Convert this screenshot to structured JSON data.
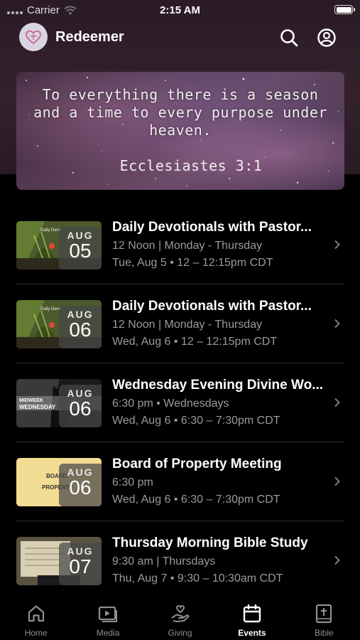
{
  "status_bar": {
    "carrier": "Carrier",
    "time": "2:15 AM"
  },
  "header": {
    "app_name": "Redeemer",
    "logo_icon": "heart-logo-icon",
    "search_icon": "search-icon",
    "profile_icon": "profile-icon"
  },
  "banner": {
    "quote": "To everything there is a season\nand a time to every purpose under\nheaven.",
    "reference": "Ecclesiastes 3:1"
  },
  "events": [
    {
      "month": "AUG",
      "day": "05",
      "title": "Daily Devotionals with Pastor...",
      "subtitle": "12 Noon | Monday - Thursday",
      "time": "Tue, Aug 5 • 12 – 12:15pm CDT",
      "thumb": "devotional"
    },
    {
      "month": "AUG",
      "day": "06",
      "title": "Daily Devotionals with Pastor...",
      "subtitle": "12 Noon | Monday - Thursday",
      "time": "Wed, Aug 6 • 12 – 12:15pm CDT",
      "thumb": "devotional"
    },
    {
      "month": "AUG",
      "day": "06",
      "title": "Wednesday Evening Divine Wo...",
      "subtitle": "6:30 pm • Wednesdays",
      "time": "Wed, Aug 6 • 6:30 – 7:30pm CDT",
      "thumb": "worship"
    },
    {
      "month": "AUG",
      "day": "06",
      "title": "Board of Property Meeting",
      "subtitle": "6:30 pm",
      "time": "Wed, Aug 6 • 6:30 – 7:30pm CDT",
      "thumb": "property"
    },
    {
      "month": "AUG",
      "day": "07",
      "title": "Thursday Morning Bible Study",
      "subtitle": "9:30 am | Thursdays",
      "time": "Thu, Aug 7 • 9:30 – 10:30am CDT",
      "thumb": "biblestudy"
    }
  ],
  "tabs": [
    {
      "label": "Home",
      "icon": "home-icon"
    },
    {
      "label": "Media",
      "icon": "media-icon"
    },
    {
      "label": "Giving",
      "icon": "giving-icon"
    },
    {
      "label": "Events",
      "icon": "calendar-icon",
      "active": true
    },
    {
      "label": "Bible",
      "icon": "bible-icon"
    }
  ],
  "colors": {
    "header_bg": "#2b1b26",
    "page_bg": "#000000",
    "secondary_text": "#9a9a9f",
    "inactive_tab": "#8e8e93"
  }
}
